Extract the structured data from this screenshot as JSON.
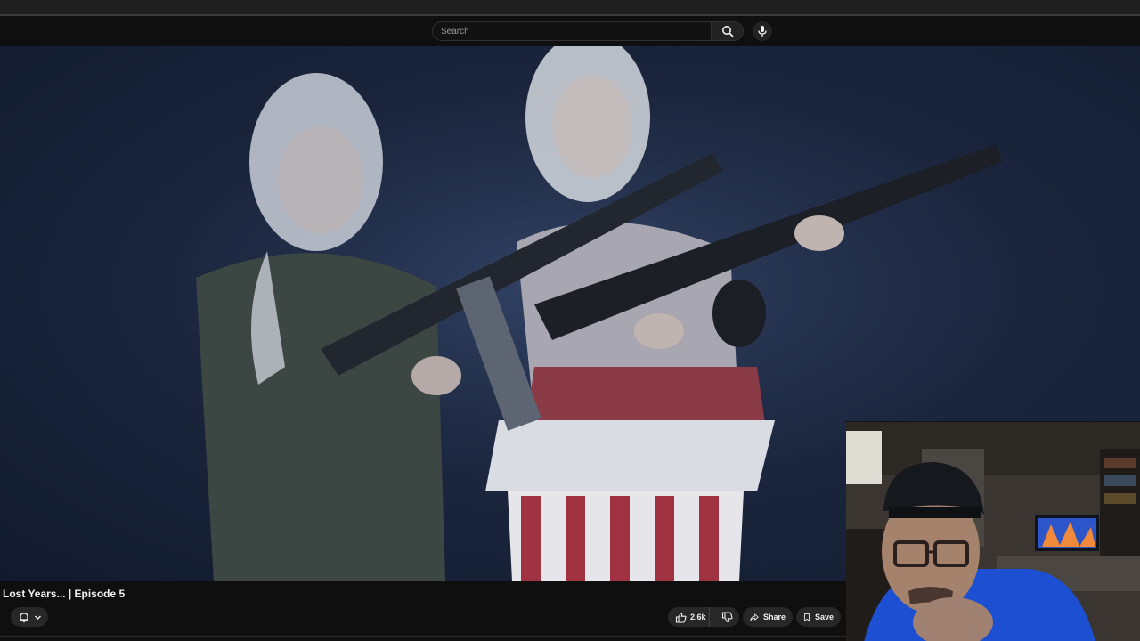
{
  "search": {
    "placeholder": "Search"
  },
  "icons": {
    "search": "search-icon",
    "mic": "microphone-icon",
    "bell": "notification-bell-icon",
    "chevron": "chevron-down-icon",
    "like": "thumbs-up-icon",
    "dislike": "thumbs-down-icon",
    "share": "share-arrow-icon",
    "save": "bookmark-icon"
  },
  "video": {
    "title": "Lost Years... | Episode 5"
  },
  "actions": {
    "like_count": "2.6k",
    "share_label": "Share",
    "save_label": "Save"
  },
  "colors": {
    "background": "#0f0f0f",
    "pill": "#272727",
    "text": "#f1f1f1"
  }
}
